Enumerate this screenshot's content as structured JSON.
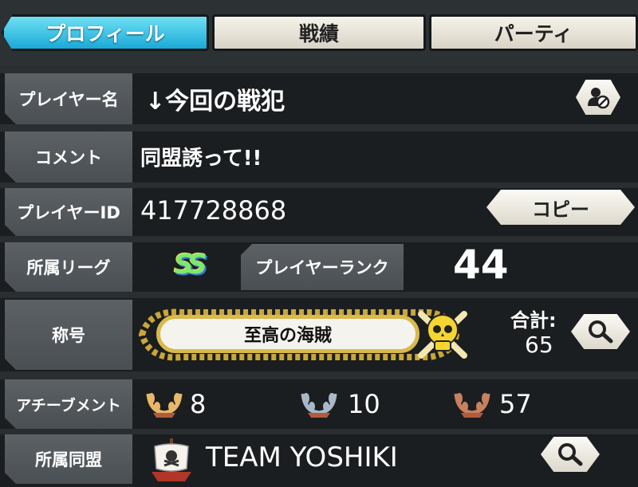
{
  "tabs": [
    {
      "label": "プロフィール",
      "active": true
    },
    {
      "label": "戦績",
      "active": false
    },
    {
      "label": "パーティ",
      "active": false
    }
  ],
  "profile": {
    "player_name_label": "プレイヤー名",
    "player_name": "↓今回の戦犯",
    "comment_label": "コメント",
    "comment": "同盟誘って!!",
    "player_id_label": "プレイヤーID",
    "player_id": "417728868",
    "copy_button": "コピー",
    "league_label": "所属リーグ",
    "league_badge": "SS",
    "rank_label": "プレイヤーランク",
    "rank": "44",
    "title_label": "称号",
    "title": "至高の海賊",
    "total_label": "合計:",
    "total": "65",
    "achievement_label": "アチーブメント",
    "achievements": [
      {
        "tier": "gold",
        "count": "8",
        "color": "#e8b86a"
      },
      {
        "tier": "silver",
        "count": "10",
        "color": "#a9b8c8"
      },
      {
        "tier": "bronze",
        "count": "57",
        "color": "#c98060"
      }
    ],
    "alliance_label": "所属同盟",
    "alliance": "TEAM YOSHIKI"
  },
  "icons": {
    "block": "block-user-icon",
    "search": "magnifier-icon",
    "skull": "skull-crossbones-icon",
    "ship": "pirate-ship-icon"
  }
}
